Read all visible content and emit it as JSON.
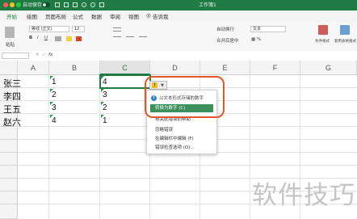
{
  "titlebar": {
    "autosave_label": "自动保存",
    "window_title": "工作簿1"
  },
  "menubar": {
    "items": [
      "开始",
      "绘图",
      "页面布局",
      "公式",
      "数据",
      "审阅",
      "视图"
    ],
    "active": "开始",
    "tell_me": "告诉我"
  },
  "ribbon": {
    "paste_label": "粘贴",
    "font_name": "等线 (正文)",
    "font_size": "12",
    "wrap_label": "自动换行",
    "merge_label": "合并后居中",
    "number_format": "文本",
    "conditional_label": "条件格式",
    "table_label": "套用表格格式"
  },
  "formula_bar": {
    "fx_label": "fx"
  },
  "sheet": {
    "columns": [
      "A",
      "B",
      "C",
      "D",
      "E",
      "F",
      "G"
    ],
    "selected_column": "C",
    "rows": [
      {
        "name": "张三",
        "b": "1",
        "c": "4"
      },
      {
        "name": "李四",
        "b": "2",
        "c": "3"
      },
      {
        "name": "王五",
        "b": "3",
        "c": "2"
      },
      {
        "name": "赵六",
        "b": "4",
        "c": "1"
      }
    ]
  },
  "error_menu": {
    "warning_glyph": "!",
    "info_glyph": "i",
    "header": "以文本形式存储的数字",
    "items": [
      "转换为数字 (C)",
      "有关此错误的帮助",
      "忽略错误",
      "在编辑栏中编辑 (F)",
      "错误检查选项 (O)..."
    ],
    "highlighted_index": 0
  },
  "colors": {
    "accent": "#1f7a43",
    "ring": "#e2582c",
    "error_indicator": "#2e9a4e",
    "warning": "#f3c21b"
  },
  "watermark": "软件技巧"
}
